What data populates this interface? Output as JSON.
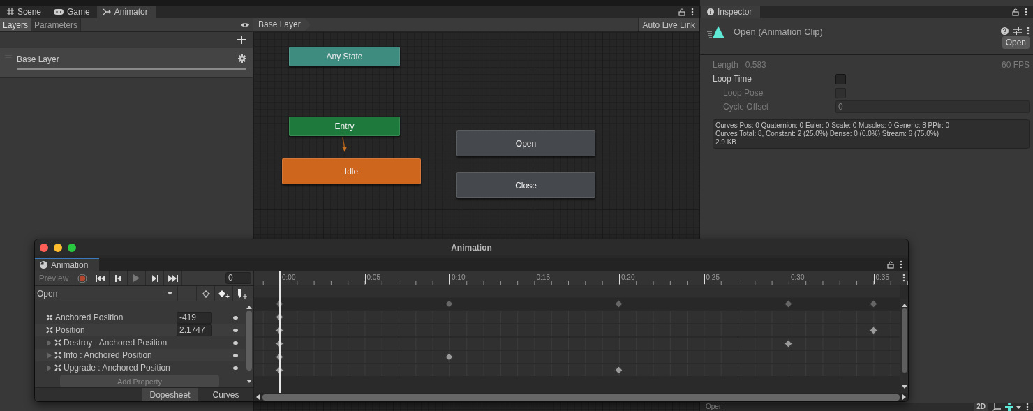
{
  "editor_tabs": [
    {
      "label": "Scene",
      "selected": false
    },
    {
      "label": "Game",
      "selected": false
    },
    {
      "label": "Animator",
      "selected": true
    }
  ],
  "animator": {
    "panel_tabs": [
      {
        "label": "Layers",
        "selected": true
      },
      {
        "label": "Parameters",
        "selected": false
      }
    ],
    "layers": [
      {
        "name": "Base Layer",
        "selected": true
      }
    ],
    "breadcrumb": "Base Layer",
    "live_link_button": "Auto Live Link",
    "states": [
      {
        "name": "Any State",
        "color": "#3e8b80"
      },
      {
        "name": "Entry",
        "color": "#1d7a3c"
      },
      {
        "name": "Idle",
        "color": "#cf661e"
      },
      {
        "name": "Open",
        "color": "#45484c"
      },
      {
        "name": "Close",
        "color": "#45484c"
      }
    ]
  },
  "inspector": {
    "tab": "Inspector",
    "title": "Open (Animation Clip)",
    "open_button": "Open",
    "length_label": "Length",
    "length_value": "0.583",
    "fps": "60 FPS",
    "loop_time": {
      "label": "Loop Time",
      "checked": false
    },
    "loop_pose": {
      "label": "Loop Pose",
      "checked": false,
      "disabled": true
    },
    "cycle_offset": {
      "label": "Cycle Offset",
      "value": "0",
      "disabled": true
    },
    "info_lines": [
      "Curves Pos: 0 Quaternion: 0 Euler: 0 Scale: 0 Muscles: 0 Generic: 8 PPtr: 0",
      "Curves Total: 8, Constant: 2 (25.0%) Dense: 0 (0.0%) Stream: 6 (75.0%)",
      "2.9 KB"
    ]
  },
  "preview": {
    "title": "Open",
    "button_2d": "2D"
  },
  "animation_window": {
    "title": "Animation",
    "tab": "Animation",
    "preview_label": "Preview",
    "frame": "0",
    "clip": "Open",
    "ruler": [
      "0:00",
      "0:05",
      "0:10",
      "0:15",
      "0:20",
      "0:25",
      "0:30",
      "0:35"
    ],
    "summary_keys": [
      true,
      false,
      true,
      false,
      true,
      false,
      true,
      true
    ],
    "properties": [
      {
        "name": "Anchored Position",
        "value": "-419",
        "expandable": false,
        "keys": [
          true,
          false,
          false,
          false,
          false,
          false,
          false,
          false
        ]
      },
      {
        "name": "Position",
        "value": "2.1747",
        "expandable": false,
        "keys": [
          true,
          false,
          false,
          false,
          false,
          false,
          false,
          true
        ]
      },
      {
        "name": "Destroy : Anchored Position",
        "expandable": true,
        "keys": [
          true,
          false,
          false,
          false,
          false,
          false,
          true,
          false
        ]
      },
      {
        "name": "Info : Anchored Position",
        "expandable": true,
        "keys": [
          true,
          false,
          true,
          false,
          false,
          false,
          false,
          false
        ]
      },
      {
        "name": "Upgrade : Anchored Position",
        "expandable": true,
        "keys": [
          true,
          false,
          false,
          false,
          true,
          false,
          false,
          false
        ]
      }
    ],
    "add_property": "Add Property",
    "view_tabs": [
      {
        "label": "Dopesheet",
        "selected": true
      },
      {
        "label": "Curves",
        "selected": false
      }
    ]
  }
}
